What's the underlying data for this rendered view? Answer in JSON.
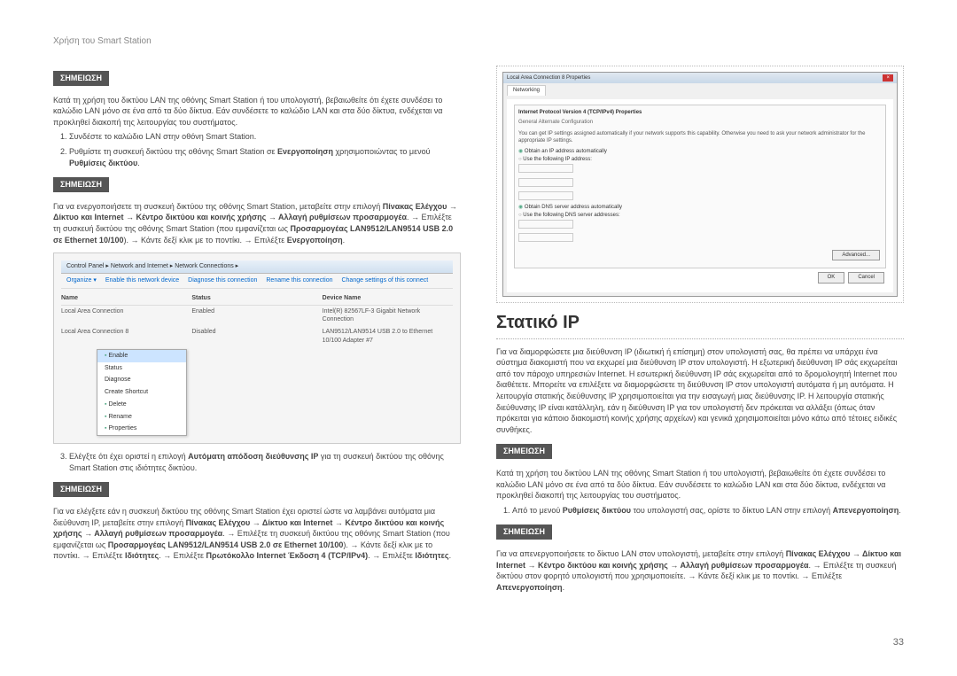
{
  "header": "Χρήση του Smart Station",
  "note_label": "ΣΗΜΕΙΩΣΗ",
  "left": {
    "intro": "Κατά τη χρήση του δικτύου LAN της οθόνης Smart Station ή του υπολογιστή, βεβαιωθείτε ότι έχετε συνδέσει το καλώδιο LAN μόνο σε ένα από τα δύο δίκτυα. Εάν συνδέσετε το καλώδιο LAN και στα δύο δίκτυα, ενδέχεται να προκληθεί διακοπή της λειτουργίας του συστήματος.",
    "li1": "Συνδέστε το καλώδιο LAN στην οθόνη Smart Station.",
    "li2_a": "Ρυθμίστε τη συσκευή δικτύου της οθόνης Smart Station σε ",
    "li2_b": "Ενεργοποίηση",
    "li2_c": " χρησιμοποιώντας το μενού ",
    "li2_d": "Ρυθμίσεις δικτύου",
    "note2_a": "Για να ενεργοποιήσετε τη συσκευή δικτύου της οθόνης Smart Station, μεταβείτε στην επιλογή ",
    "note2_b": "Πίνακας Ελέγχου → Δίκτυο και Internet → Κέντρο δικτύου και κοινής χρήσης → Αλλαγή ρυθμίσεων προσαρμογέα",
    "note2_c": ". → Επιλέξτε τη συσκευή δικτύου της οθόνης Smart Station (που εμφανίζεται ως ",
    "note2_d": "Προσαρμογέας LAN9512/LAN9514 USB 2.0 σε Ethernet 10/100",
    "note2_e": "). → Κάντε δεξί κλικ με το ποντίκι. → Επιλέξτε ",
    "note2_f": "Ενεργοποίηση",
    "li3_a": "Ελέγξτε ότι έχει οριστεί η επιλογή ",
    "li3_b": "Αυτόματη απόδοση διεύθυνσης IP",
    "li3_c": " για τη συσκευή δικτύου της οθόνης Smart Station στις ιδιότητες δικτύου.",
    "note3_a": "Για να ελέγξετε εάν η συσκευή δικτύου της οθόνης Smart Station έχει οριστεί ώστε να λαμβάνει αυτόματα μια διεύθυνση IP, μεταβείτε στην επιλογή ",
    "note3_b": "Πίνακας Ελέγχου → Δίκτυο και Internet → Κέντρο δικτύου και κοινής χρήσης → Αλλαγή ρυθμίσεων προσαρμογέα",
    "note3_c": ". → Επιλέξτε τη συσκευή δικτύου της οθόνης Smart Station (που εμφανίζεται ως ",
    "note3_d": "Προσαρμογέας LAN9512/LAN9514 USB 2.0 σε Ethernet 10/100",
    "note3_e": "). → Κάντε δεξί κλικ με το ποντίκι. → Επιλέξτε ",
    "note3_f": "Ιδιότητες",
    "note3_g": ". → Επιλέξτε ",
    "note3_h": "Πρωτόκολλο Internet Έκδοση 4 (TCP/IPv4)",
    "note3_i": ". → Επιλέξτε ",
    "note3_j": "Ιδιότητες"
  },
  "ss1": {
    "crumb": "Control Panel ▸ Network and Internet ▸ Network Connections ▸",
    "tb": [
      "Organize ▾",
      "Enable this network device",
      "Diagnose this connection",
      "Rename this connection",
      "Change settings of this connect"
    ],
    "th": [
      "Name",
      "Status",
      "Device Name"
    ],
    "r1": [
      "Local Area Connection",
      "Enabled",
      "Intel(R) 82567LF-3 Gigabit Network Connection"
    ],
    "r2": [
      "Local Area Connection 8",
      "Disabled",
      "LAN9512/LAN9514 USB 2.0 to Ethernet 10/100 Adapter #7"
    ],
    "menu": [
      "Enable",
      "Status",
      "Diagnose",
      "Create Shortcut",
      "Delete",
      "Rename",
      "Properties"
    ]
  },
  "ss2": {
    "title": "Local Area Connection 8 Properties",
    "tab": "Networking",
    "item": "Internet Protocol Version 4 (TCP/IPv4) Properties",
    "subtab": "General   Alternate Configuration",
    "desc": "You can get IP settings assigned automatically if your network supports this capability. Otherwise you need to ask your network administrator for the appropriate IP settings.",
    "r1": "Obtain an IP address automatically",
    "r2": "Use the following IP address:",
    "r3": "Obtain DNS server address automatically",
    "r4": "Use the following DNS server addresses:",
    "adv": "Advanced...",
    "ok": "OK",
    "cancel": "Cancel"
  },
  "right": {
    "title": "Στατικό IP",
    "intro": "Για να διαμορφώσετε μια διεύθυνση IP (ιδιωτική ή επίσημη) στον υπολογιστή σας, θα πρέπει να υπάρχει ένα σύστημα διακομιστή που να εκχωρεί μια διεύθυνση IP στον υπολογιστή. Η εξωτερική διεύθυνση IP σάς εκχωρείται από τον πάροχο υπηρεσιών Internet. Η εσωτερική διεύθυνση IP σάς εκχωρείται από το δρομολογητή Internet που διαθέτετε. Μπορείτε να επιλέξετε να διαμορφώσετε τη διεύθυνση IP στον υπολογιστή αυτόματα ή μη αυτόματα. Η λειτουργία στατικής διεύθυνσης IP χρησιμοποιείται για την εισαγωγή μιας διεύθυνσης IP. Η λειτουργία στατικής διεύθυνσης IP είναι κατάλληλη, εάν η διεύθυνση IP για τον υπολογιστή δεν πρόκειται να αλλάξει (όπως όταν πρόκειται για κάποιο διακομιστή κοινής χρήσης αρχείων) και γενικά χρησιμοποιείται μόνο κάτω από τέτοιες ειδικές συνθήκες.",
    "note1": "Κατά τη χρήση του δικτύου LAN της οθόνης Smart Station ή του υπολογιστή, βεβαιωθείτε ότι έχετε συνδέσει το καλώδιο LAN μόνο σε ένα από τα δύο δίκτυα. Εάν συνδέσετε το καλώδιο LAN και στα δύο δίκτυα, ενδέχεται να προκληθεί διακοπή της λειτουργίας του συστήματος.",
    "li1_a": "Από το μενού ",
    "li1_b": "Ρυθμίσεις δικτύου",
    "li1_c": " του υπολογιστή σας, ορίστε το δίκτυο LAN στην επιλογή ",
    "li1_d": "Απενεργοποίηση",
    "note2_a": "Για να απενεργοποιήσετε το δίκτυο LAN στον υπολογιστή, μεταβείτε στην επιλογή ",
    "note2_b": "Πίνακας Ελέγχου → Δίκτυο και Internet → Κέντρο δικτύου και κοινής χρήσης → Αλλαγή ρυθμίσεων προσαρμογέα",
    "note2_c": ". → Επιλέξτε τη συσκευή δικτύου στον φορητό υπολογιστή που χρησιμοποιείτε. → Κάντε δεξί κλικ με το ποντίκι. → Επιλέξτε ",
    "note2_d": "Απενεργοποίηση"
  },
  "page_num": "33"
}
